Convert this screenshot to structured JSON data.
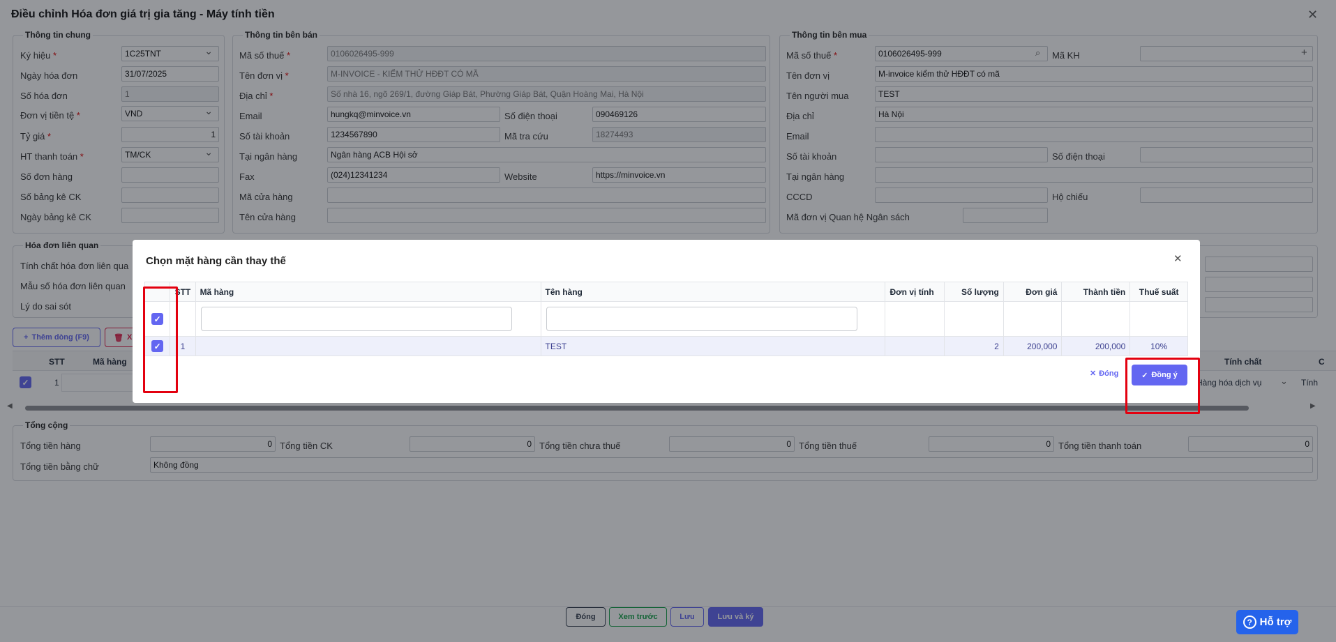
{
  "window": {
    "title": "Điều chỉnh Hóa đơn giá trị gia tăng - Máy tính tiền"
  },
  "general_info": {
    "title": "Thông tin chung",
    "fields": {
      "ky_hieu_label": "Ký hiệu",
      "ky_hieu_value": "1C25TNT",
      "ngay_label": "Ngày hóa đơn",
      "ngay_value": "31/07/2025",
      "so_hd_label": "Số hóa đơn",
      "so_hd_value": "1",
      "tien_te_label": "Đơn vị tiền tệ",
      "tien_te_value": "VND",
      "ty_gia_label": "Tỷ giá",
      "ty_gia_value": "1",
      "httt_label": "HT thanh toán",
      "httt_value": "TM/CK",
      "so_don_hang_label": "Số đơn hàng",
      "so_bang_ke_label": "Số bảng kê CK",
      "ngay_bang_ke_label": "Ngày bảng kê CK"
    }
  },
  "seller": {
    "title": "Thông tin bên bán",
    "mst_label": "Mã số thuế",
    "mst_value": "0106026495-999",
    "ten_label": "Tên đơn vị",
    "ten_value": "M-INVOICE - KIỂM THỬ HĐĐT CÓ MÃ",
    "diachi_label": "Địa chỉ",
    "diachi_value": "Số nhà 16, ngõ 269/1, đường Giáp Bát, Phường Giáp Bát, Quận Hoàng Mai, Hà Nội",
    "email_label": "Email",
    "email_value": "hungkq@minvoice.vn",
    "sdt_label": "Số điện thoại",
    "sdt_value": "090469126",
    "stk_label": "Số tài khoản",
    "stk_value": "1234567890",
    "matracuu_label": "Mã tra cứu",
    "matracuu_value": "18274493",
    "nganhang_label": "Tại ngân hàng",
    "nganhang_value": "Ngân hàng ACB Hội sở",
    "fax_label": "Fax",
    "fax_value": "(024)12341234",
    "website_label": "Website",
    "website_value": "https://minvoice.vn",
    "macuahang_label": "Mã cửa hàng",
    "tencuahang_label": "Tên cửa hàng"
  },
  "buyer": {
    "title": "Thông tin bên mua",
    "mst_label": "Mã số thuế",
    "mst_value": "0106026495-999",
    "makh_label": "Mã KH",
    "ten_label": "Tên đơn vị",
    "ten_value": "M-invoice kiểm thử HĐĐT có mã",
    "nguoimua_label": "Tên người mua",
    "nguoimua_value": "TEST",
    "diachi_label": "Địa chỉ",
    "diachi_value": "Hà Nội",
    "email_label": "Email",
    "stk_label": "Số tài khoản",
    "sdt_label": "Số điện thoại",
    "nganhang_label": "Tại ngân hàng",
    "cccd_label": "CCCD",
    "hochieu_label": "Hộ chiếu",
    "madvqhns_label": "Mã đơn vị Quan hệ Ngân sách"
  },
  "related": {
    "title": "Hóa đơn liên quan",
    "tinhchat_label": "Tính chất hóa đơn liên qua",
    "mauso_label": "Mẫu số hóa đơn liên quan",
    "lydo_label": "Lý do sai sót"
  },
  "toolbar": {
    "add_row": "Thêm dòng (F9)",
    "delete_partial": "X"
  },
  "lines": {
    "headers": {
      "stt": "STT",
      "ma_hang": "Mã hàng",
      "tinh_chat": "Tính chất",
      "c": "C"
    },
    "row": {
      "stt": "1",
      "tinh_chat": "Hàng hóa dịch vụ",
      "tinh": "Tính"
    }
  },
  "totals": {
    "title": "Tổng cộng",
    "tong_tien_hang_label": "Tổng tiền hàng",
    "tong_tien_hang": "0",
    "tong_ck_label": "Tổng tiền CK",
    "tong_ck": "0",
    "chua_thue_label": "Tổng tiền chưa thuế",
    "chua_thue": "0",
    "tien_thue_label": "Tổng tiền thuế",
    "tien_thue": "0",
    "thanh_toan_label": "Tổng tiền thanh toán",
    "thanh_toan": "0",
    "bang_chu_label": "Tổng tiền bằng chữ",
    "bang_chu": "Không đồng"
  },
  "footer": {
    "close": "Đóng",
    "preview": "Xem trước",
    "save": "Lưu",
    "save_sign": "Lưu và ký"
  },
  "help": {
    "label": "Hỗ trợ"
  },
  "modal": {
    "title": "Chọn mặt hàng cần thay thế",
    "headers": {
      "stt": "STT",
      "ma_hang": "Mã hàng",
      "ten_hang": "Tên hàng",
      "dvt": "Đơn vị tính",
      "so_luong": "Số lượng",
      "don_gia": "Đơn giá",
      "thanh_tien": "Thành tiền",
      "thue_suat": "Thuế suất"
    },
    "row": {
      "stt": "1",
      "ma_hang": "",
      "ten_hang": "TEST",
      "dvt": "",
      "so_luong": "2",
      "don_gia": "200,000",
      "thanh_tien": "200,000",
      "thue_suat": "10%"
    },
    "close_label": "Đóng",
    "ok_label": "Đồng ý"
  },
  "colors": {
    "primary": "#6366f1",
    "annotation_red": "#e3000f"
  }
}
